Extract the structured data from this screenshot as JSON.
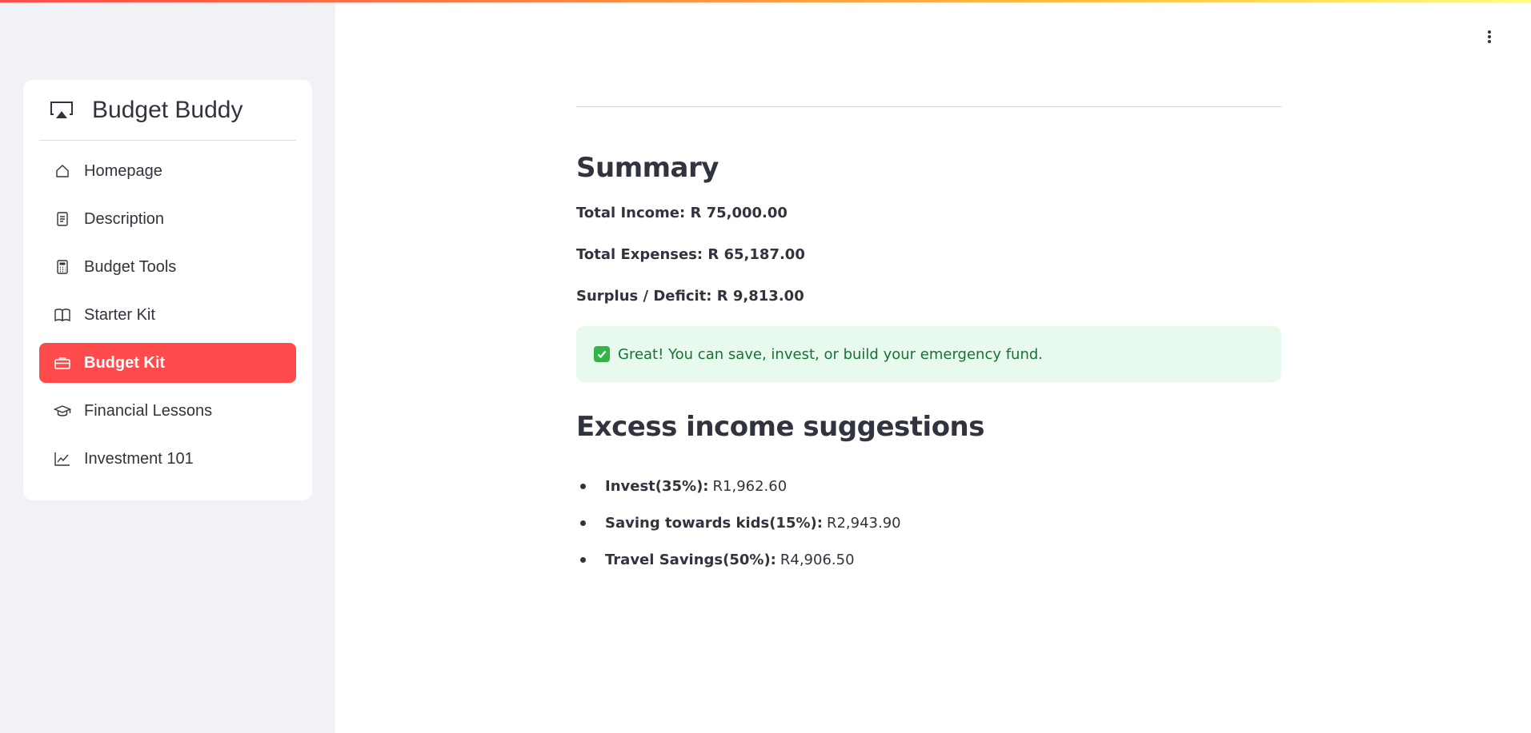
{
  "app": {
    "title": "Budget Buddy",
    "icon": "airplay-icon",
    "accent_color": "#ff4b4b"
  },
  "sidebar": {
    "items": [
      {
        "label": "Homepage",
        "icon": "home-icon",
        "active": false
      },
      {
        "label": "Description",
        "icon": "document-icon",
        "active": false
      },
      {
        "label": "Budget Tools",
        "icon": "calculator-icon",
        "active": false
      },
      {
        "label": "Starter Kit",
        "icon": "book-icon",
        "active": false
      },
      {
        "label": "Budget Kit",
        "icon": "briefcase-icon",
        "active": true
      },
      {
        "label": "Financial Lessons",
        "icon": "graduation-cap-icon",
        "active": false
      },
      {
        "label": "Investment 101",
        "icon": "line-chart-icon",
        "active": false
      }
    ]
  },
  "header": {
    "menu_icon": "vertical-dots-icon"
  },
  "summary": {
    "heading": "Summary",
    "total_income_label": "Total Income:",
    "total_income_value": "R 75,000.00",
    "total_expenses_label": "Total Expenses:",
    "total_expenses_value": "R 65,187.00",
    "surplus_label": "Surplus / Deficit:",
    "surplus_value": "R 9,813.00"
  },
  "alert": {
    "icon": "check-mark-icon",
    "message": "Great! You can save, invest, or build your emergency fund.",
    "color": "#177233",
    "background": "#e8f9ee"
  },
  "suggestions": {
    "heading": "Excess income suggestions",
    "items": [
      {
        "label": "Invest(35%):",
        "value": "R1,962.60"
      },
      {
        "label": "Saving towards kids(15%):",
        "value": "R2,943.90"
      },
      {
        "label": "Travel Savings(50%):",
        "value": "R4,906.50"
      }
    ]
  }
}
